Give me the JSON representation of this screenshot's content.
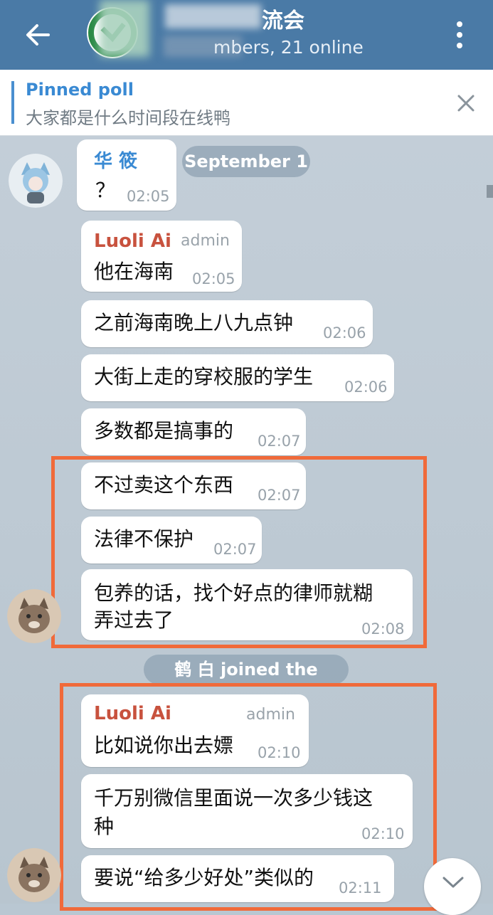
{
  "header": {
    "title": "流会",
    "subtitle": "mbers, 21 online"
  },
  "pinned": {
    "label": "Pinned poll",
    "text": "大家都是什么时间段在线鸭"
  },
  "date_chip": "September 1",
  "messages": [
    {
      "sender": "华 筱",
      "text": "？",
      "time": "02:05"
    },
    {
      "sender": "Luoli Ai",
      "role": "admin",
      "text": "他在海南",
      "time": "02:05"
    },
    {
      "text": "之前海南晚上八九点钟",
      "time": "02:06"
    },
    {
      "text": "大街上走的穿校服的学生",
      "time": "02:06"
    },
    {
      "text": "多数都是搞事的",
      "time": "02:07"
    },
    {
      "text": "不过卖这个东西",
      "time": "02:07"
    },
    {
      "text": "法律不保护",
      "time": "02:07"
    },
    {
      "text_line1": "包养的话，找个好点的律师就糊",
      "text_line2": "弄过去了",
      "time": "02:08"
    }
  ],
  "join_notice": "鹤 白 joined the group",
  "messages2": [
    {
      "sender": "Luoli Ai",
      "role": "admin",
      "text": "比如说你出去嫖",
      "time": "02:10"
    },
    {
      "text_line1": "千万别微信里面说一次多少钱这",
      "text_line2": "种",
      "time": "02:10"
    },
    {
      "text": "要说“给多少好处”类似的",
      "time": "02:11"
    }
  ],
  "colors": {
    "header": "#4a7aa6",
    "accent_blue": "#3a8ad3",
    "sender_red": "#c8523e",
    "highlight": "#f06a3a"
  }
}
